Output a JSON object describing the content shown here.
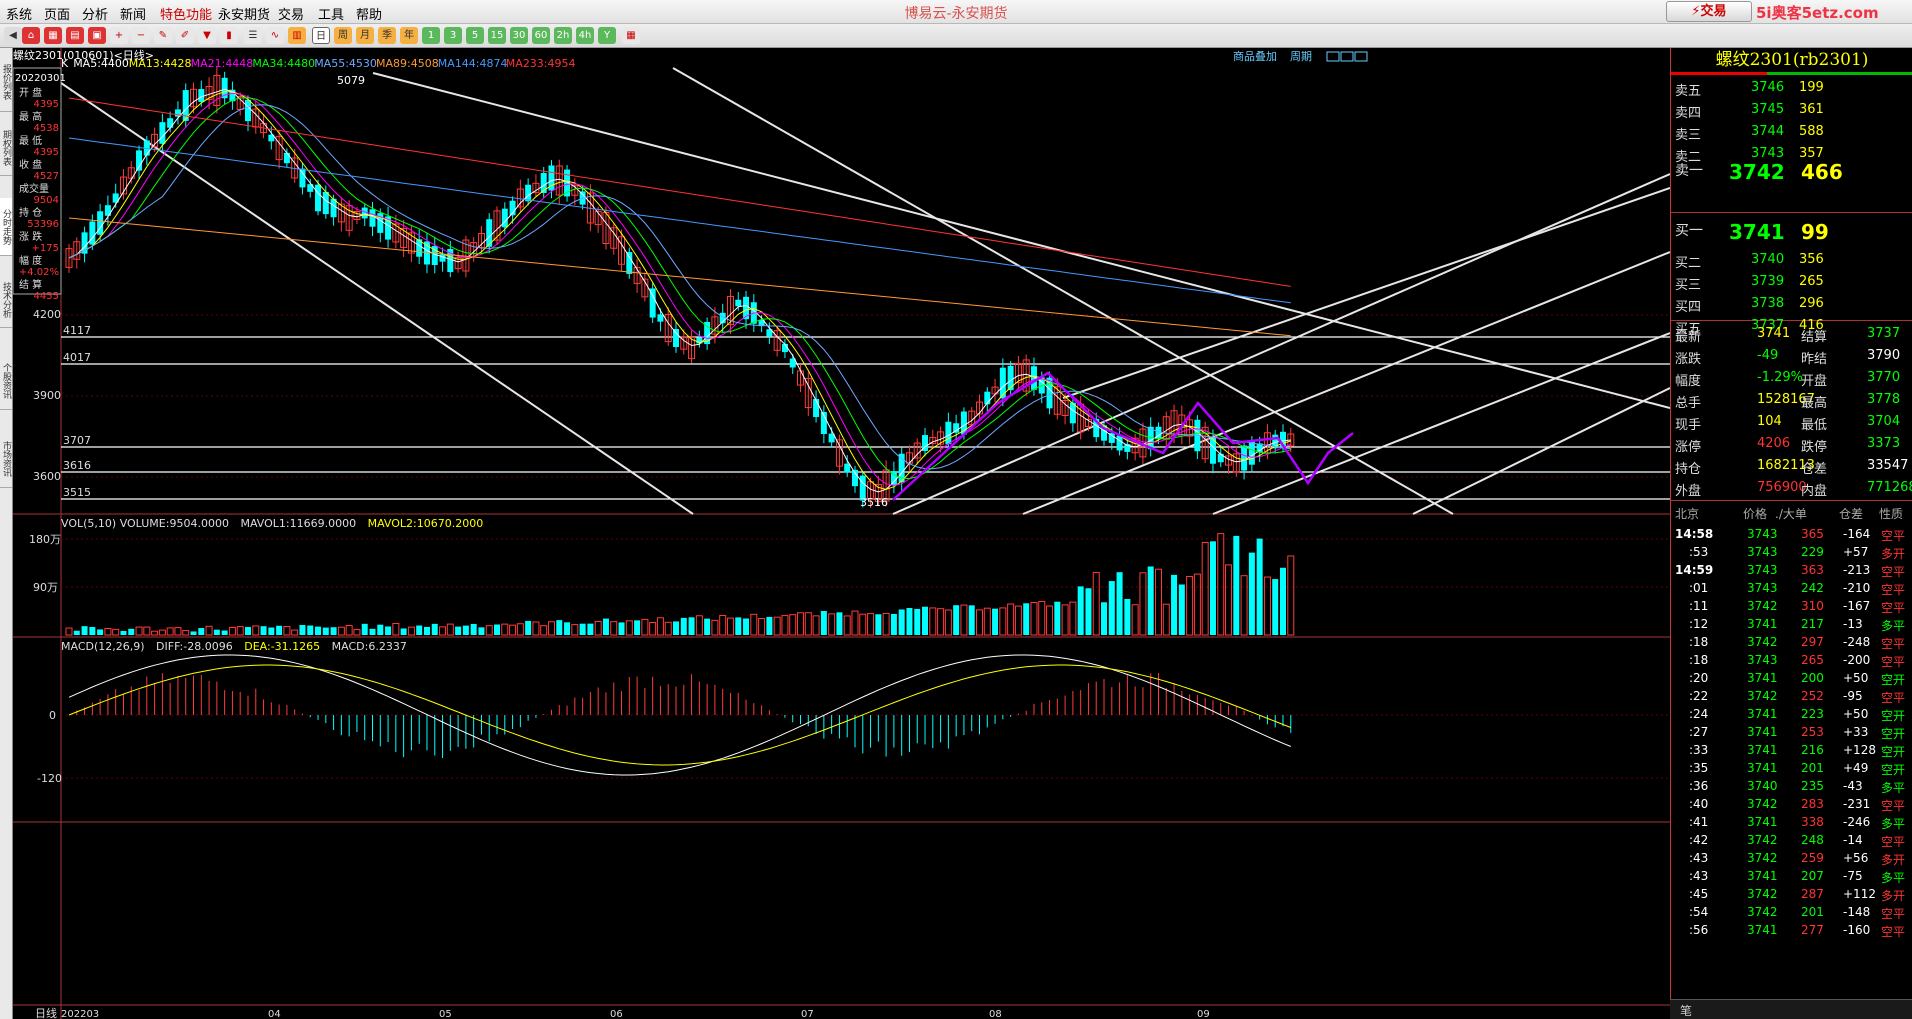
{
  "menu": {
    "items": [
      "系统",
      "页面",
      "分析",
      "新闻",
      "特色功能",
      "永安期货",
      "交易",
      "工具",
      "帮助"
    ],
    "app_title": "博易云-永安期货",
    "trade_button": "⚡交易",
    "watermark": "5i奥客5etz.com"
  },
  "toolbar": {
    "buttons": [
      "1",
      "3",
      "5",
      "15",
      "30",
      "60",
      "2h",
      "4h",
      "Y"
    ]
  },
  "left_tabs": [
    "报价列表",
    "期权列表",
    "分时走势",
    "技术分析",
    "个股资讯",
    "市场资讯"
  ],
  "chart": {
    "symbol_line": "螺纹2301(010601)<日线>",
    "links": [
      "商品叠加",
      "周期"
    ],
    "ma_legend": [
      {
        "label": "K",
        "color": "#ffffff"
      },
      {
        "label": "MA5:4400",
        "color": "#ffffff"
      },
      {
        "label": "MA13:4428",
        "color": "#ffff00"
      },
      {
        "label": "MA21:4448",
        "color": "#ff00ff"
      },
      {
        "label": "MA34:4480",
        "color": "#00ff00"
      },
      {
        "label": "MA55:4530",
        "color": "#6fa8ff"
      },
      {
        "label": "MA89:4508",
        "color": "#ff9933"
      },
      {
        "label": "MA144:4874",
        "color": "#4499ff"
      },
      {
        "label": "MA233:4954",
        "color": "#ff3333"
      }
    ],
    "info_box": {
      "date": "20220301",
      "items": [
        {
          "label": "开 盘",
          "value": "4395"
        },
        {
          "label": "最 高",
          "value": "4538"
        },
        {
          "label": "最 低",
          "value": "4395"
        },
        {
          "label": "收 盘",
          "value": "4527"
        },
        {
          "label": "成交量",
          "value": "9504"
        },
        {
          "label": "持 仓",
          "value": "53396"
        },
        {
          "label": "涨 跌",
          "value": "+175"
        },
        {
          "label": "幅 度",
          "value": "+4.02%"
        },
        {
          "label": "结 算",
          "value": "4455"
        }
      ]
    },
    "price_axis": [
      "4200",
      "3900",
      "3600"
    ],
    "hlines": [
      "4117",
      "4017",
      "3707",
      "3616",
      "3515"
    ],
    "peak_label": "5079",
    "trough_label": "3516",
    "vol_legend": "VOL(5,10) VOLUME:9504.0000",
    "mavol1": "MAVOL1:11669.0000",
    "mavol2": "MAVOL2:10670.2000",
    "vol_axis": [
      "180万",
      "90万"
    ],
    "macd_legend": "MACD(12,26,9)",
    "macd_diff": "DIFF:-28.0096",
    "macd_dea": "DEA:-31.1265",
    "macd_macd": "MACD:6.2337",
    "macd_axis": [
      "0",
      "-120"
    ],
    "period_label": "日线",
    "dates": [
      "202203",
      "04",
      "05",
      "06",
      "07",
      "08",
      "09"
    ]
  },
  "quote": {
    "title": "螺纹2301(rb2301)",
    "asks": [
      {
        "label": "卖五",
        "price": "3746",
        "vol": "199"
      },
      {
        "label": "卖四",
        "price": "3745",
        "vol": "361"
      },
      {
        "label": "卖三",
        "price": "3744",
        "vol": "588"
      },
      {
        "label": "卖二",
        "price": "3743",
        "vol": "357"
      },
      {
        "label": "卖一",
        "price": "3742",
        "vol": "466"
      }
    ],
    "bids": [
      {
        "label": "买一",
        "price": "3741",
        "vol": "99"
      },
      {
        "label": "买二",
        "price": "3740",
        "vol": "356"
      },
      {
        "label": "买三",
        "price": "3739",
        "vol": "265"
      },
      {
        "label": "买四",
        "price": "3738",
        "vol": "296"
      },
      {
        "label": "买五",
        "price": "3737",
        "vol": "416"
      }
    ],
    "stats": [
      [
        "最新",
        "3741",
        "结算",
        "3737"
      ],
      [
        "涨跌",
        "-49",
        "昨结",
        "3790"
      ],
      [
        "幅度",
        "-1.29%",
        "开盘",
        "3770"
      ],
      [
        "总手",
        "1528167",
        "最高",
        "3778"
      ],
      [
        "现手",
        "104",
        "最低",
        "3704"
      ],
      [
        "涨停",
        "4206",
        "跌停",
        "3373"
      ],
      [
        "持仓",
        "1682113",
        "仓差",
        "33547"
      ],
      [
        "外盘",
        "756900",
        "内盘",
        "771268"
      ]
    ],
    "tick_header": [
      "北京",
      "价格",
      "./大单",
      "仓差",
      "性质"
    ],
    "ticks": [
      [
        "14:58",
        "3743",
        "365",
        "-164",
        "空平"
      ],
      [
        ":53",
        "3743",
        "229",
        "+57",
        "多开"
      ],
      [
        "14:59",
        "3743",
        "363",
        "-213",
        "空平"
      ],
      [
        ":01",
        "3743",
        "242",
        "-210",
        "空平"
      ],
      [
        ":11",
        "3742",
        "310",
        "-167",
        "空平"
      ],
      [
        ":12",
        "3741",
        "217",
        "-13",
        "多平"
      ],
      [
        ":18",
        "3742",
        "297",
        "-248",
        "空平"
      ],
      [
        ":18",
        "3743",
        "265",
        "-200",
        "空平"
      ],
      [
        ":20",
        "3741",
        "200",
        "+50",
        "空开"
      ],
      [
        ":22",
        "3742",
        "252",
        "-95",
        "空平"
      ],
      [
        ":24",
        "3741",
        "223",
        "+50",
        "空开"
      ],
      [
        ":27",
        "3741",
        "253",
        "+33",
        "空开"
      ],
      [
        ":33",
        "3741",
        "216",
        "+128",
        "空开"
      ],
      [
        ":35",
        "3741",
        "201",
        "+49",
        "空开"
      ],
      [
        ":36",
        "3740",
        "235",
        "-43",
        "多平"
      ],
      [
        ":40",
        "3742",
        "283",
        "-231",
        "空平"
      ],
      [
        ":41",
        "3741",
        "338",
        "-246",
        "多平"
      ],
      [
        ":42",
        "3742",
        "248",
        "-14",
        "空平"
      ],
      [
        ":43",
        "3742",
        "259",
        "+56",
        "多开"
      ],
      [
        ":43",
        "3741",
        "207",
        "-75",
        "多平"
      ],
      [
        ":45",
        "3742",
        "287",
        "+112",
        "多开"
      ],
      [
        ":54",
        "3742",
        "201",
        "-148",
        "空平"
      ],
      [
        ":56",
        "3741",
        "277",
        "-160",
        "空平"
      ]
    ],
    "bottom_label": "笔"
  }
}
